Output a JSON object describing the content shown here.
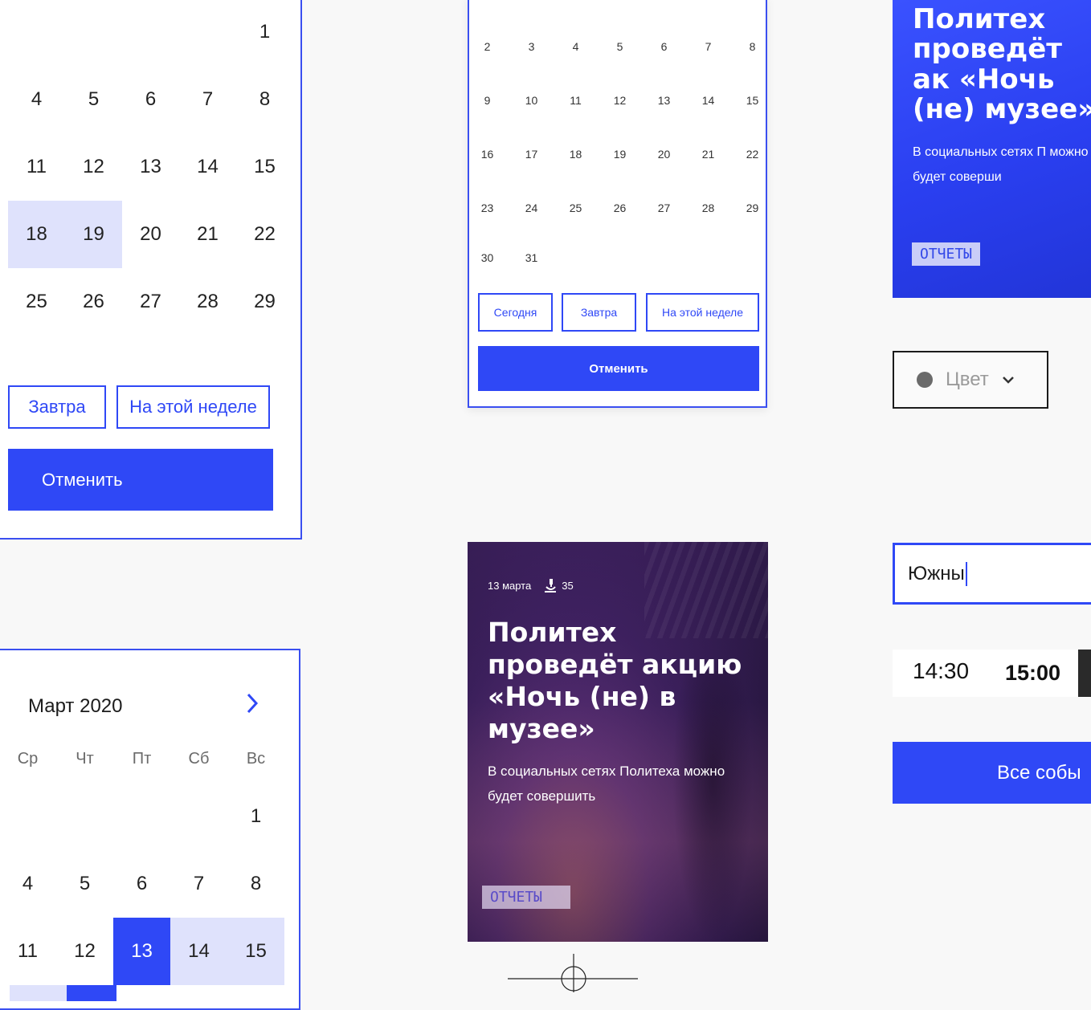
{
  "calendar_top_left": {
    "rows": [
      [
        {
          "d": ""
        },
        {
          "d": ""
        },
        {
          "d": ""
        },
        {
          "d": ""
        },
        {
          "d": "1"
        }
      ],
      [
        {
          "d": "4"
        },
        {
          "d": "5"
        },
        {
          "d": "6"
        },
        {
          "d": "7"
        },
        {
          "d": "8"
        }
      ],
      [
        {
          "d": "11"
        },
        {
          "d": "12"
        },
        {
          "d": "13"
        },
        {
          "d": "14"
        },
        {
          "d": "15"
        }
      ],
      [
        {
          "d": "18",
          "s": "range"
        },
        {
          "d": "19",
          "s": "range"
        },
        {
          "d": "20"
        },
        {
          "d": "21"
        },
        {
          "d": "22"
        }
      ],
      [
        {
          "d": "25"
        },
        {
          "d": "26"
        },
        {
          "d": "27"
        },
        {
          "d": "28"
        },
        {
          "d": "29"
        }
      ]
    ],
    "tomorrow_label": "Завтра",
    "this_week_label": "На этой неделе",
    "cancel_label": "Отменить"
  },
  "calendar_mid": {
    "rows": [
      [
        "2",
        "3",
        "4",
        "5",
        "6",
        "7",
        "8"
      ],
      [
        "9",
        "10",
        "11",
        "12",
        "13",
        "14",
        "15"
      ],
      [
        "16",
        "17",
        "18",
        "19",
        "20",
        "21",
        "22"
      ],
      [
        "23",
        "24",
        "25",
        "26",
        "27",
        "28",
        "29"
      ],
      [
        "30",
        "31",
        "",
        "",
        "",
        "",
        ""
      ]
    ],
    "today_label": "Сегодня",
    "tomorrow_label": "Завтра",
    "this_week_label": "На этой неделе",
    "cancel_label": "Отменить"
  },
  "calendar_bottom_left": {
    "month_label": "Март 2020",
    "next_icon": "chevron-right-icon",
    "weekdays": [
      "Ср",
      "Чт",
      "Пт",
      "Сб",
      "Вс"
    ],
    "rows": [
      [
        {
          "d": ""
        },
        {
          "d": ""
        },
        {
          "d": ""
        },
        {
          "d": ""
        },
        {
          "d": "1"
        }
      ],
      [
        {
          "d": "4"
        },
        {
          "d": "5"
        },
        {
          "d": "6"
        },
        {
          "d": "7"
        },
        {
          "d": "8"
        }
      ],
      [
        {
          "d": "11"
        },
        {
          "d": "12"
        },
        {
          "d": "13",
          "s": "sel"
        },
        {
          "d": "14",
          "s": "range"
        },
        {
          "d": "15",
          "s": "range"
        }
      ]
    ]
  },
  "event_card_center": {
    "date": "13 марта",
    "views_icon": "microscope-icon",
    "views": "35",
    "title": "Политех проведёт акцию «Ночь (не) в музее»",
    "description": "В социальных сетях Политеха можно будет совершить",
    "tag": "ОТЧЕТЫ"
  },
  "event_card_right": {
    "title": "Политех проведёт ак «Ночь (не) музее»",
    "description": "В социальных сетях П можно будет соверши",
    "tag": "ОТЧЕТЫ"
  },
  "color_select": {
    "dot_icon": "color-dot-icon",
    "label": "Цвет",
    "arrow_icon": "chevron-down-icon"
  },
  "search": {
    "value": "Южны"
  },
  "time_slots": [
    "14:30",
    "15:00"
  ],
  "all_events_label": "Все собы",
  "colors": {
    "accent": "#2f48f6",
    "range": "#dfe2fc",
    "background": "#f8f8f8"
  }
}
